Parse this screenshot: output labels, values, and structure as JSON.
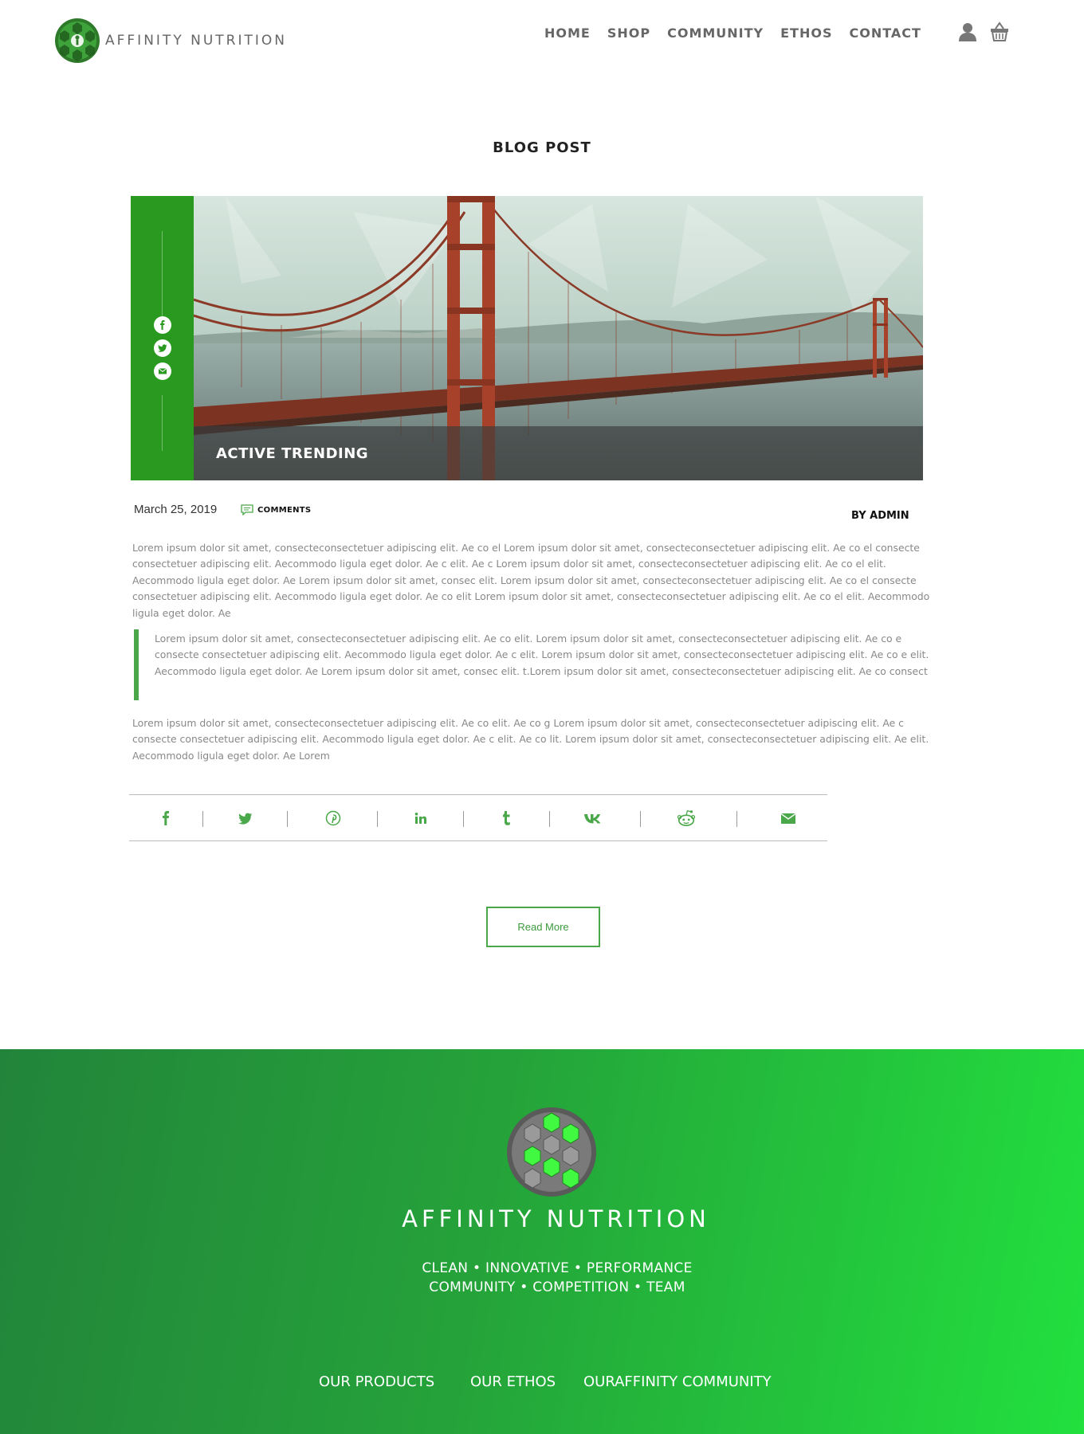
{
  "header": {
    "brand": "AFFINITY NUTRITION",
    "nav": [
      "HOME",
      "SHOP",
      "COMMUNITY",
      "ETHOS",
      "CONTACT"
    ]
  },
  "page": {
    "title": "BLOG POST"
  },
  "post": {
    "hero_caption": "ACTIVE TRENDING",
    "date": "March 25, 2019",
    "comments_label": "COMMENTS",
    "author": "BY ADMIN",
    "paragraph1": "Lorem ipsum dolor sit amet, consecteconsectetuer adipiscing elit. Ae co el Lorem ipsum dolor sit amet, consecteconsectetuer adipiscing elit. Ae co el consecte consectetuer adipiscing elit. Aecommodo ligula eget dolor. Ae c elit. Ae c Lorem ipsum dolor sit amet, consecteconsectetuer adipiscing elit. Ae co el elit. Aecommodo ligula eget dolor. Ae Lorem ipsum dolor sit amet, consec elit. Lorem ipsum dolor sit amet, consecteconsectetuer adipiscing elit. Ae co el consecte consectetuer adipiscing elit. Aecommodo ligula eget dolor. Ae co elit  Lorem ipsum dolor sit amet, consecteconsectetuer adipiscing elit. Ae co el elit. Aecommodo ligula eget dolor. Ae",
    "quote": "Lorem ipsum dolor sit amet, consecteconsectetuer adipiscing elit. Ae co elit. Lorem ipsum dolor sit amet, consecteconsectetuer adipiscing elit. Ae co e consecte consectetuer adipiscing elit. Aecommodo ligula eget dolor. Ae c elit. Lorem ipsum dolor sit amet, consecteconsectetuer adipiscing elit. Ae co e elit. Aecommodo ligula eget dolor. Ae Lorem ipsum dolor sit amet, consec elit. t.Lorem ipsum dolor sit amet, consecteconsectetuer adipiscing elit. Ae co consect",
    "paragraph3": "Lorem ipsum dolor sit amet, consecteconsectetuer adipiscing elit. Ae co elit. Ae co g Lorem ipsum dolor sit amet, consecteconsectetuer adipiscing elit. Ae c consecte consectetuer adipiscing elit. Aecommodo ligula eget dolor. Ae c elit. Ae co lit. Lorem ipsum dolor sit amet, consecteconsectetuer adipiscing elit. Ae elit. Aecommodo ligula eget dolor. Ae Lorem",
    "rail_icons": [
      "facebook-icon",
      "twitter-icon",
      "email-icon"
    ],
    "share_icons": [
      "facebook-icon",
      "twitter-icon",
      "pinterest-icon",
      "linkedin-icon",
      "tumblr-icon",
      "vk-icon",
      "reddit-icon",
      "email-icon"
    ],
    "read_more": "Read More"
  },
  "footer": {
    "brand": "AFFINITY NUTRITION",
    "tagline1": "CLEAN • INNOVATIVE • PERFORMANCE",
    "tagline2": "COMMUNITY • COMPETITION • TEAM",
    "links": [
      "OUR PRODUCTS",
      "OUR ETHOS",
      "OURAFFINITY COMMUNITY"
    ]
  },
  "colors": {
    "accent_green": "#2a9920",
    "share_green": "#4aa84a",
    "footer_gradient_start": "#22843a",
    "footer_gradient_end": "#22e03e"
  }
}
